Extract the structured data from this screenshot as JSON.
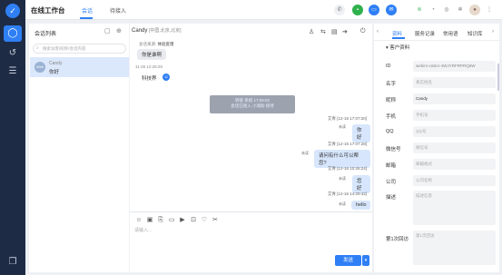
{
  "app": {
    "title": "在线工作台",
    "tabs": [
      {
        "label": "会话"
      },
      {
        "label": "待接入"
      }
    ]
  },
  "sessions": {
    "title": "会话列表",
    "search_placeholder": "搜索访客/昵称/会话内容",
    "items": [
      {
        "avatar": "Web",
        "name": "Candy",
        "last_message": "你好"
      }
    ]
  },
  "chat": {
    "visitor_name": "Candy",
    "location": "[中国,北京,北京]",
    "source_label": "会话来源:",
    "source_value": "体验反馈",
    "messages": [
      {
        "from": "visitor",
        "text": "你是谁啊"
      },
      {
        "timestamp": "11-26 12:28:26"
      },
      {
        "from": "visitor",
        "text": "科技界"
      },
      {
        "system": [
          "转接 系统 17:08:02",
          "会话已接入 小瑞助 接待"
        ]
      },
      {
        "agent": "艾青 [12-15 17:07:20]",
        "status": "未读",
        "text": "你好"
      },
      {
        "agent": "艾青 [12-15 17:07:28]",
        "status": "未读",
        "text": "请问有什么可以帮您?"
      },
      {
        "agent": "艾青 [12-16 10:26:24]",
        "status": "未读",
        "text": "您好"
      },
      {
        "agent": "艾青 [12-16 14:29:42]",
        "status": "未读",
        "text": "hello"
      }
    ],
    "input_placeholder": "请输入...",
    "send_label": "发送"
  },
  "profile": {
    "tabs": [
      {
        "label": "资料"
      },
      {
        "label": "服务记录"
      },
      {
        "label": "常用语"
      },
      {
        "label": "知识库"
      }
    ],
    "section_title": "客户资料",
    "fields": [
      {
        "label": "ID",
        "value": "webim-visitor-4WJYRFRPRQ6W",
        "filled": true
      },
      {
        "label": "名字",
        "value": "真实姓名",
        "filled": false
      },
      {
        "label": "昵称",
        "value": "Candy",
        "filled": true
      },
      {
        "label": "手机",
        "value": "手机号",
        "filled": false
      },
      {
        "label": "QQ",
        "value": "QQ号",
        "filled": false
      },
      {
        "label": "微信号",
        "value": "微信号",
        "filled": false
      },
      {
        "label": "邮箱",
        "value": "邮箱格式",
        "filled": false
      },
      {
        "label": "公司",
        "value": "公司名称",
        "filled": false
      },
      {
        "label": "描述",
        "value": "描述信息",
        "filled": false
      },
      {
        "label": "第1次回访",
        "value": "第1次回访",
        "filled": false
      }
    ]
  },
  "colors": {
    "accent": "#2f7ff5",
    "sidebar": "#1e2b45"
  }
}
